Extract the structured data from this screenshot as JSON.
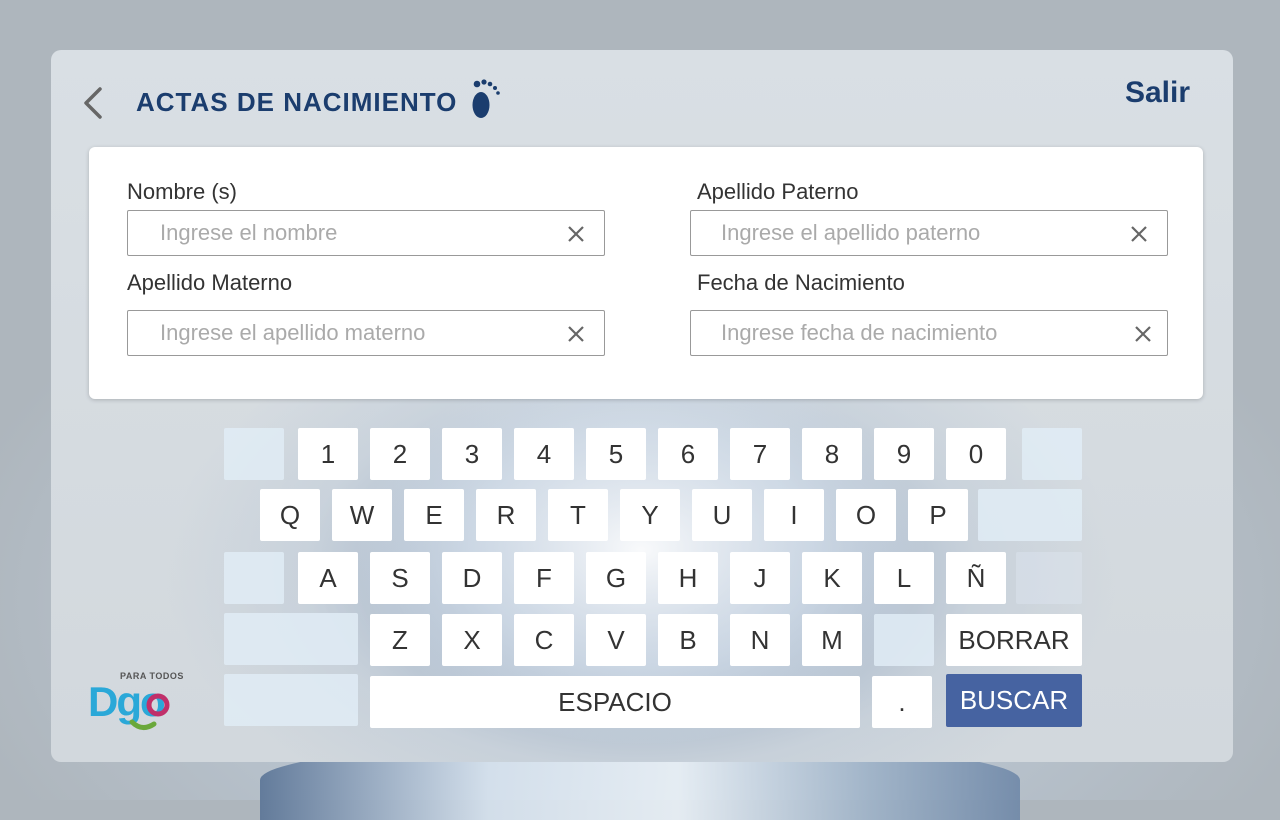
{
  "header": {
    "title": "ACTAS DE NACIMIENTO",
    "exit_label": "Salir",
    "back_icon": "chevron-left-icon",
    "title_icon": "footprint-icon",
    "accent_color": "#1b3d6e"
  },
  "form": {
    "nombre": {
      "label": "Nombre (s)",
      "placeholder": "Ingrese el nombre",
      "value": ""
    },
    "apellido_paterno": {
      "label": "Apellido Paterno",
      "placeholder": "Ingrese el apellido paterno",
      "value": ""
    },
    "apellido_materno": {
      "label": "Apellido Materno",
      "placeholder": "Ingrese el apellido materno",
      "value": ""
    },
    "fecha_nacimiento": {
      "label": "Fecha de Nacimiento",
      "placeholder": "Ingrese fecha de nacimiento",
      "value": ""
    }
  },
  "keyboard": {
    "numbers": [
      "1",
      "2",
      "3",
      "4",
      "5",
      "6",
      "7",
      "8",
      "9",
      "0"
    ],
    "row_q": [
      "Q",
      "W",
      "E",
      "R",
      "T",
      "Y",
      "U",
      "I",
      "O",
      "P"
    ],
    "row_a": [
      "A",
      "S",
      "D",
      "F",
      "G",
      "H",
      "J",
      "K",
      "L",
      "Ñ"
    ],
    "row_z": [
      "Z",
      "X",
      "C",
      "V",
      "B",
      "N",
      "M"
    ],
    "borrar": "BORRAR",
    "espacio": "ESPACIO",
    "period": ".",
    "buscar": "BUSCAR",
    "buscar_color": "#4663a1"
  },
  "logo": {
    "small_text": "PARA TODOS",
    "main_text": "Dgo"
  }
}
